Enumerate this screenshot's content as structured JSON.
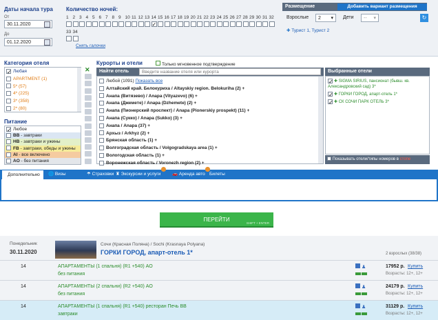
{
  "search": {
    "dates_title": "Даты начала тура",
    "from_label": "От",
    "from_value": "30.11.2020",
    "to_label": "До",
    "to_value": "01.12.2020",
    "nights_title": "Количество ночей:",
    "nights_row1": [
      "1",
      "2",
      "3",
      "4",
      "5",
      "6",
      "7",
      "8",
      "9",
      "10",
      "11",
      "12",
      "13",
      "14",
      "15",
      "16",
      "17",
      "18",
      "19",
      "20",
      "21",
      "22",
      "23",
      "24",
      "25",
      "26",
      "27",
      "28",
      "29",
      "30",
      "31",
      "32"
    ],
    "nights_row2": [
      "33",
      "34"
    ],
    "nights_checked": "14",
    "uncheck_link": "Снять галочки"
  },
  "placement": {
    "title": "Размещение",
    "add_variant_label": "Добавить вариант размещения",
    "adults_label": "Взрослые",
    "adults_value": "2",
    "children_label": "Дети",
    "children_value": "--",
    "tourists_text": "Турист 1, Турист 2"
  },
  "hotel_category": {
    "title": "Категория отеля",
    "items": [
      {
        "label": "Любая",
        "checked": true,
        "color": "#1a3e8a"
      },
      {
        "label": "APARTMENT (1)",
        "checked": false,
        "color": "#e07a10"
      },
      {
        "label": "5* (57)",
        "checked": false,
        "color": "#e07a10"
      },
      {
        "label": "4* (225)",
        "checked": false,
        "color": "#e07a10"
      },
      {
        "label": "3* (358)",
        "checked": false,
        "color": "#e07a10"
      },
      {
        "label": "2* (80)",
        "checked": false,
        "color": "#e07a10"
      }
    ]
  },
  "meals": {
    "title": "Питание",
    "items": [
      {
        "code": "",
        "desc": "Любое",
        "checked": true,
        "bg": "#ffffff"
      },
      {
        "code": "BB",
        "desc": " - завтраки",
        "checked": false,
        "bg": "#dbe6f3"
      },
      {
        "code": "HB",
        "desc": " - завтраки и ужины",
        "checked": false,
        "bg": "#e3f0c8"
      },
      {
        "code": "FB",
        "desc": " - завтраки, обеды и ужины",
        "checked": false,
        "bg": "#f6ec9a"
      },
      {
        "code": "AI",
        "desc": " - все включено",
        "checked": false,
        "bg": "#f5cba0"
      },
      {
        "code": "AO",
        "desc": " - без питания",
        "checked": false,
        "bg": "#e3e6ea"
      }
    ]
  },
  "resorts": {
    "title": "Курорты и отели",
    "instant_label": "Только мгновенное подтверждение",
    "find_hotel_label": "Найти отель",
    "find_placeholder": "Введите название отеля или курорта",
    "selected_title": "Выбранные отели",
    "any_label": "Любой (1091)",
    "show_all": "Показать все",
    "list": [
      "Алтайский край. Белокуриха / Altayskiy region. Belokuriha (2) +",
      "Анапа (Витязево) / Anapa (Vityazevo) (6) +",
      "Анапа (Джемете) / Anapa (Dzhemete) (2) +",
      "Анапа (Пионерский проспект) / Anapa (Pionerskiy prospekt) (11) +",
      "Анапа (Сукко) / Anapa (Sukko) (3) +",
      "Анапа / Anapa (37) +",
      "Архыз / Arkhyz (2) +",
      "Брянская область (1) +",
      "Волгоградская область / Volgogradskaya area (1) +",
      "Вологодская область (1) +",
      "Воронежская область / Voronezh region (2) +"
    ],
    "selected": [
      "SIGMA SIRIUS, пансионат (бывш. кв. Александровский сад) 3*",
      "ГОРКИ ГОРОД, апарт-отель 1*",
      "СК СОЧИ ПАРК ОТЕЛЬ 3*"
    ],
    "show_rooms_label": "Показывать отели/типы номеров в",
    "show_rooms_stop": "стопе"
  },
  "tabs": [
    {
      "label": "Дополнительно"
    },
    {
      "label": "Визы"
    },
    {
      "label": "Страховки"
    },
    {
      "label": "Экскурсии и услуги"
    },
    {
      "label": "Аренда авто"
    },
    {
      "label": "Билеты"
    }
  ],
  "go_button": {
    "label": "ПЕРЕЙТИ",
    "hint": "SHIFT + ENTER"
  },
  "result": {
    "weekday": "Понедельник",
    "date": "30.11.2020",
    "location": "Сочи (Красная Поляна) / Sochi (Krasnaya Polyana)",
    "hotel": "ГОРКИ ГОРОД, апарт-отель 1*",
    "count": "2 взрослых (38/38)",
    "offers": [
      {
        "nights": "14",
        "room": "АПАРТАМЕНТЫ (1 спальня) (R1 +540) AO",
        "meal": "без питания",
        "price": "17952 р.",
        "buy": "Купить",
        "ages": "Возрасты: 12+, 12+"
      },
      {
        "nights": "14",
        "room": "АПАРТАМЕНТЫ (2 спальни) (R2 +540) AO",
        "meal": "без питания",
        "price": "24179 р.",
        "buy": "Купить",
        "ages": "Возрасты: 12+, 12+"
      },
      {
        "nights": "14",
        "room": "АПАРТАМЕНТЫ (1 спальня) (R1 +540) ресторан Печь ВВ",
        "meal": "завтраки",
        "price": "31129 р.",
        "buy": "Купить",
        "ages": "Возрасты: 12+, 12+"
      }
    ]
  }
}
